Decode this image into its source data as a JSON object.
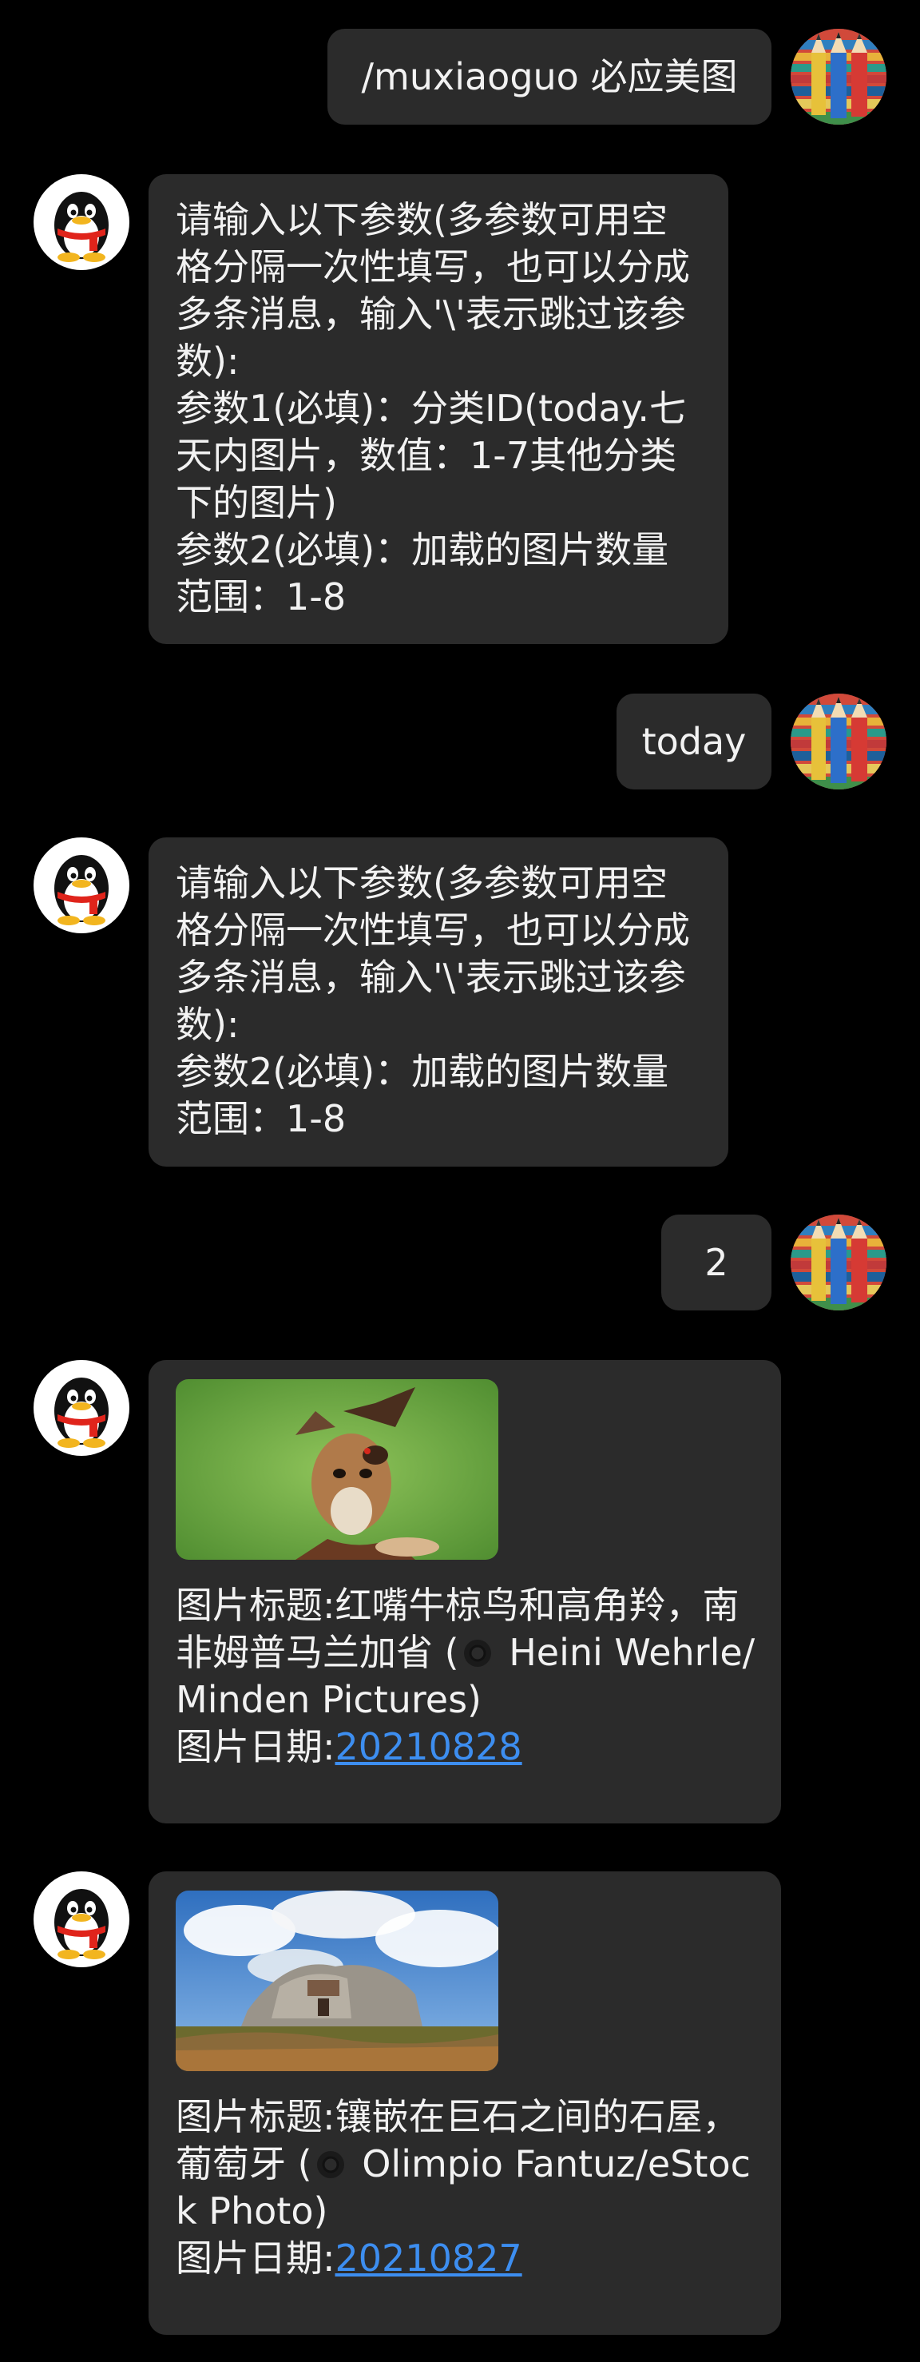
{
  "messages": [
    {
      "id": "m1",
      "side": "out",
      "text": "/muxiaoguo 必应美图"
    },
    {
      "id": "m2",
      "side": "in",
      "text": "请输入以下参数(多参数可用空格分隔一次性填写，也可以分成多条消息，输入'\\'表示跳过该参数):\n参数1(必填)：分类ID(today.七天内图片，数值：1-7其他分类下的图片)\n参数2(必填)：加载的图片数量范围：1-8"
    },
    {
      "id": "m3",
      "side": "out",
      "text": "today"
    },
    {
      "id": "m4",
      "side": "in",
      "text": "请输入以下参数(多参数可用空格分隔一次性填写，也可以分成多条消息，输入'\\'表示跳过该参数):\n参数2(必填)：加载的图片数量范围：1-8"
    },
    {
      "id": "m5",
      "side": "out",
      "text": "2"
    },
    {
      "id": "m6",
      "side": "in",
      "image": "antelope-with-oxpeckers-photo",
      "title_label": "图片标题:",
      "title": "红嘴牛椋鸟和高角羚，南非姆普马兰加省 (",
      "credit": " Heini Wehrle/Minden Pictures)",
      "date_label": "图片日期:",
      "date": "20210828"
    },
    {
      "id": "m7",
      "side": "in",
      "image": "boulder-stone-house-photo",
      "title_label": "图片标题:",
      "title": "镶嵌在巨石之间的石屋，葡萄牙 (",
      "credit": " Olimpio Fantuz/eStock Photo)",
      "date_label": "图片日期:",
      "date": "20210827"
    }
  ],
  "colors": {
    "background": "#000000",
    "bubble": "#2b2b2b",
    "text": "#f2f2f2",
    "link": "#3d8ef0"
  },
  "icons": {
    "user_avatar": "colored-pencils-avatar",
    "bot_avatar": "qq-penguin-avatar",
    "credit": "copyright-circle-icon"
  }
}
